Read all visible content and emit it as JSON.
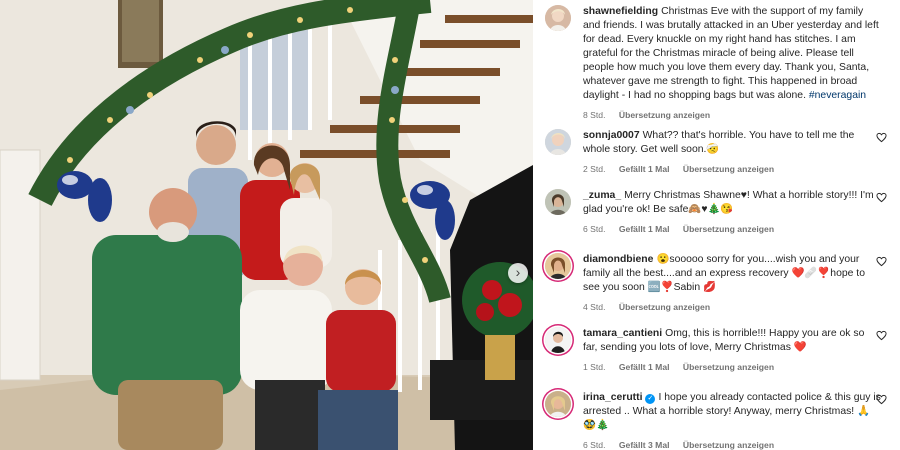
{
  "post": {
    "username": "shawnefielding",
    "caption": "Christmas Eve with the support of my family and friends. I was brutally attacked in an Uber yesterday and left for dead. Every knuckle on my right hand has stitches. I am grateful for the Christmas miracle of being alive. Please tell people how much you love them every day. Thank you, Santa, whatever gave me strength to fight. This happened in broad daylight - I had no shopping bags but was alone.",
    "hashtag": "#neveragain",
    "time": "8 Std.",
    "translate": "Übersetzung anzeigen"
  },
  "comments": [
    {
      "username": "sonnja0007",
      "text": "What?? that's horrible. You have to tell me the whole story. Get well soon.🤕",
      "time": "2 Std.",
      "likes": "Gefällt 1 Mal",
      "translate": "Übersetzung anzeigen"
    },
    {
      "username": "_zuma_",
      "text": "Merry Christmas Shawne♥! What a horrible story!!! I'm glad you're ok! Be safe🙈♥🎄😘",
      "time": "6 Std.",
      "likes": "Gefällt 1 Mal",
      "translate": "Übersetzung anzeigen"
    },
    {
      "username": "diamondbiene",
      "text": "😮sooooo sorry for you....wish you and your family all the best....and an express recovery ❤️🩹❣️hope to see you soon 🆒❣️Sabin 💋",
      "time": "4 Std.",
      "likes": "",
      "translate": "Übersetzung anzeigen"
    },
    {
      "username": "tamara_cantieni",
      "text": "Omg, this is horrible!!! Happy you are ok so far, sending you lots of love, Merry Christmas ❤️",
      "time": "1 Std.",
      "likes": "Gefällt 1 Mal",
      "translate": "Übersetzung anzeigen"
    },
    {
      "username": "irina_cerutti",
      "text": "I hope you already contacted police & this guy is arrested .. What a horrible story! Anyway, merry Christmas! 🙏🥸🎄",
      "time": "6 Std.",
      "likes": "Gefällt 3 Mal",
      "translate": "Übersetzung anzeigen"
    }
  ],
  "icons": {
    "heart": "heart-outline-icon",
    "next": "chevron-right-icon",
    "verified": "verified-badge-icon"
  },
  "colors": {
    "hashtag": "#00376b",
    "verified": "#0095f6",
    "meta": "#737373",
    "story_ring": "#d62976"
  }
}
